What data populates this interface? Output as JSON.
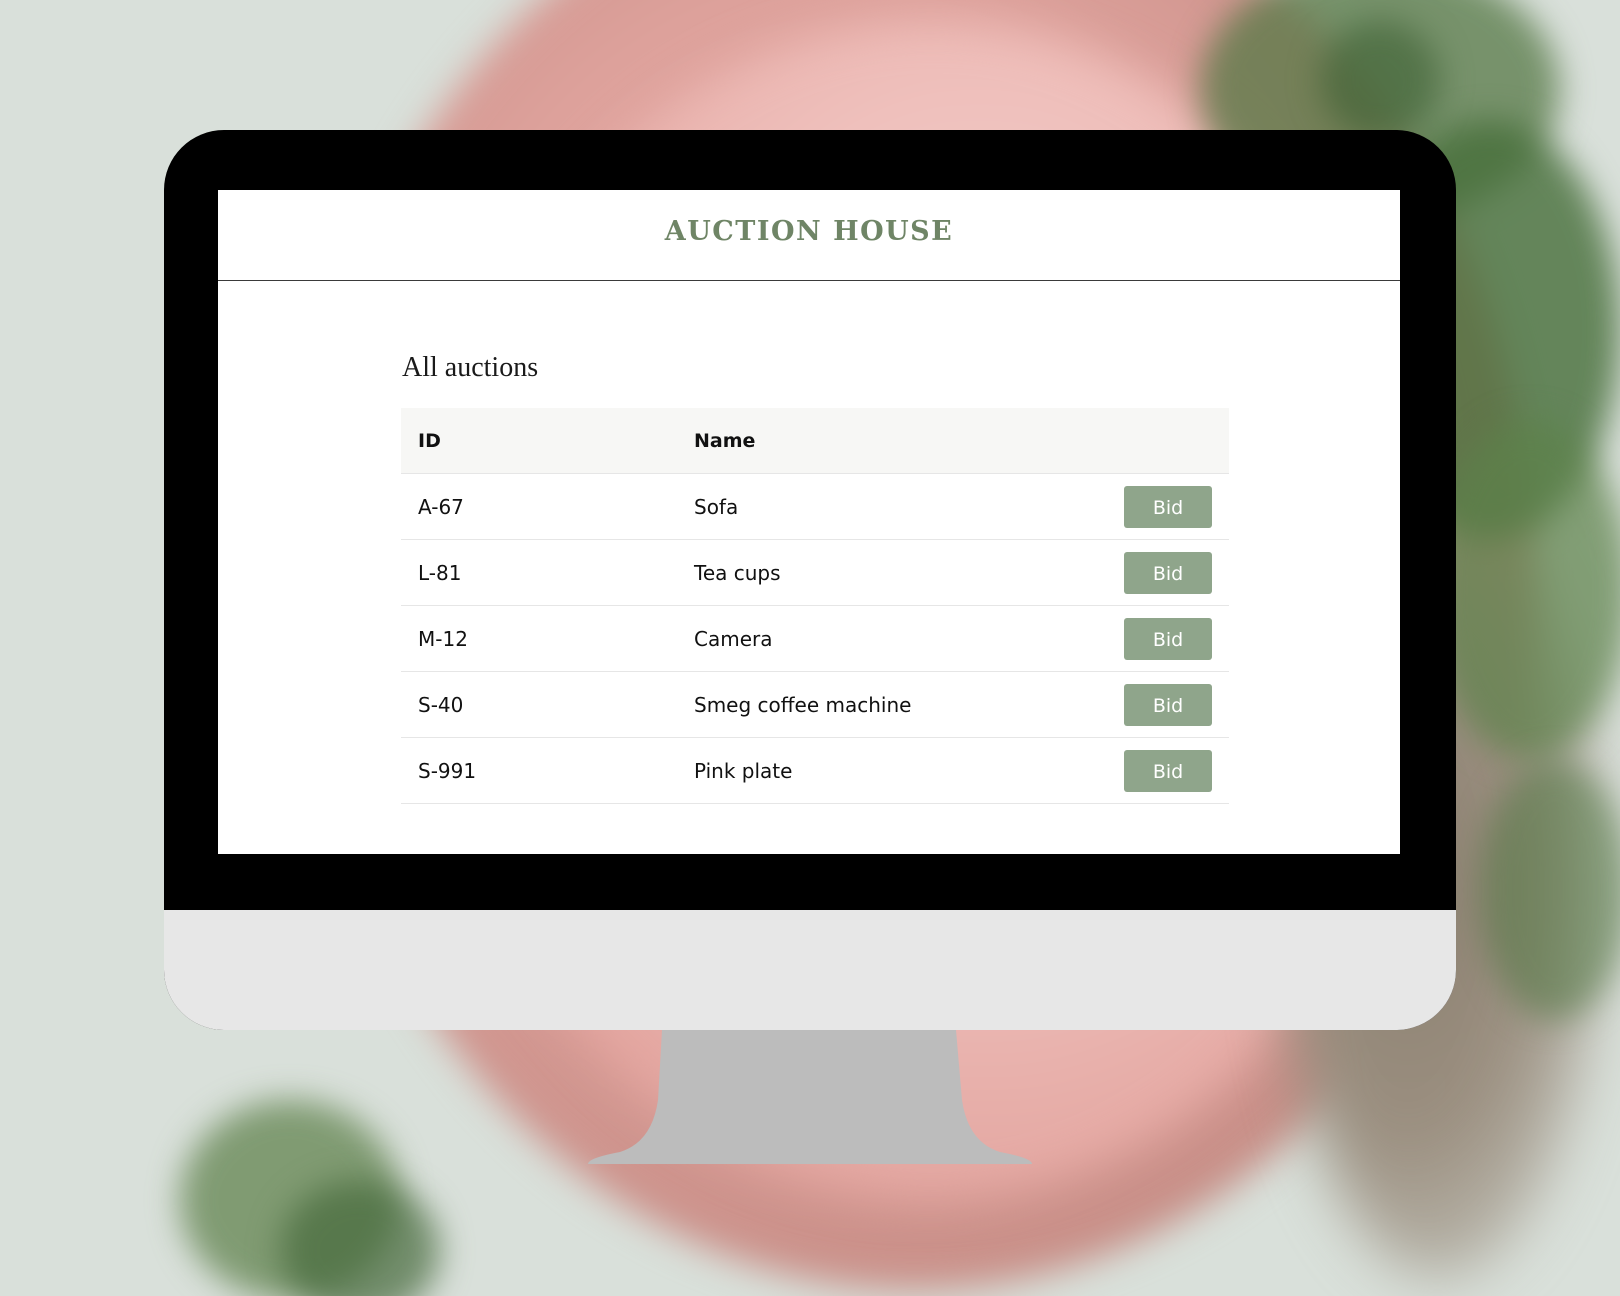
{
  "site": {
    "brand": "AUCTION HOUSE"
  },
  "page": {
    "section_title": "All auctions"
  },
  "table": {
    "headers": {
      "id": "ID",
      "name": "Name",
      "action": ""
    },
    "rows": [
      {
        "id": "A-67",
        "name": "Sofa",
        "action_label": "Bid"
      },
      {
        "id": "L-81",
        "name": "Tea cups",
        "action_label": "Bid"
      },
      {
        "id": "M-12",
        "name": "Camera",
        "action_label": "Bid"
      },
      {
        "id": "S-40",
        "name": "Smeg coffee machine",
        "action_label": "Bid"
      },
      {
        "id": "S-991",
        "name": "Pink plate",
        "action_label": "Bid"
      }
    ]
  },
  "colors": {
    "brand": "#6f8566",
    "button": "#8fa58b",
    "monitor_bezel": "#000000",
    "monitor_chin": "#e7e7e7",
    "stand": "#bcbcbc"
  }
}
